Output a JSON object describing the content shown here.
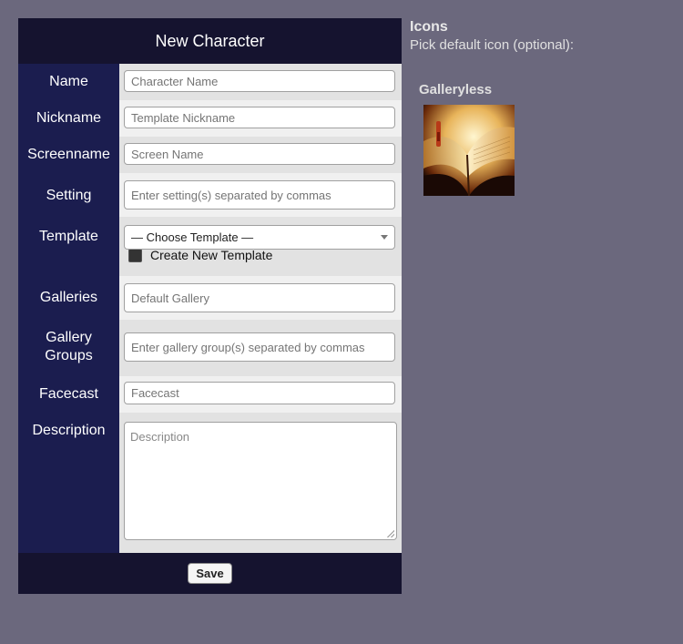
{
  "form": {
    "title": "New Character",
    "fields": {
      "name": {
        "label": "Name",
        "placeholder": "Character Name"
      },
      "nickname": {
        "label": "Nickname",
        "placeholder": "Template Nickname"
      },
      "screenname": {
        "label": "Screenname",
        "placeholder": "Screen Name"
      },
      "setting": {
        "label": "Setting",
        "placeholder": "Enter setting(s) separated by commas"
      },
      "template": {
        "label": "Template",
        "selected": "— Choose Template —",
        "checkbox_label": "Create New Template"
      },
      "galleries": {
        "label": "Galleries",
        "placeholder": "Default Gallery"
      },
      "gallery_groups": {
        "label_line1": "Gallery",
        "label_line2": "Groups",
        "placeholder": "Enter gallery group(s) separated by commas"
      },
      "facecast": {
        "label": "Facecast",
        "placeholder": "Facecast"
      },
      "description": {
        "label": "Description",
        "placeholder": "Description"
      }
    },
    "save_label": "Save"
  },
  "icons": {
    "title": "Icons",
    "subtitle": "Pick default icon (optional):",
    "gallery_name": "Galleryless",
    "icon_name": "open-book-icon"
  },
  "colors": {
    "background": "#6b687d",
    "header": "#15132f",
    "label_column": "#1b1d4f",
    "row_light": "#e2e2e2",
    "row_alt": "#f0f0f0"
  }
}
